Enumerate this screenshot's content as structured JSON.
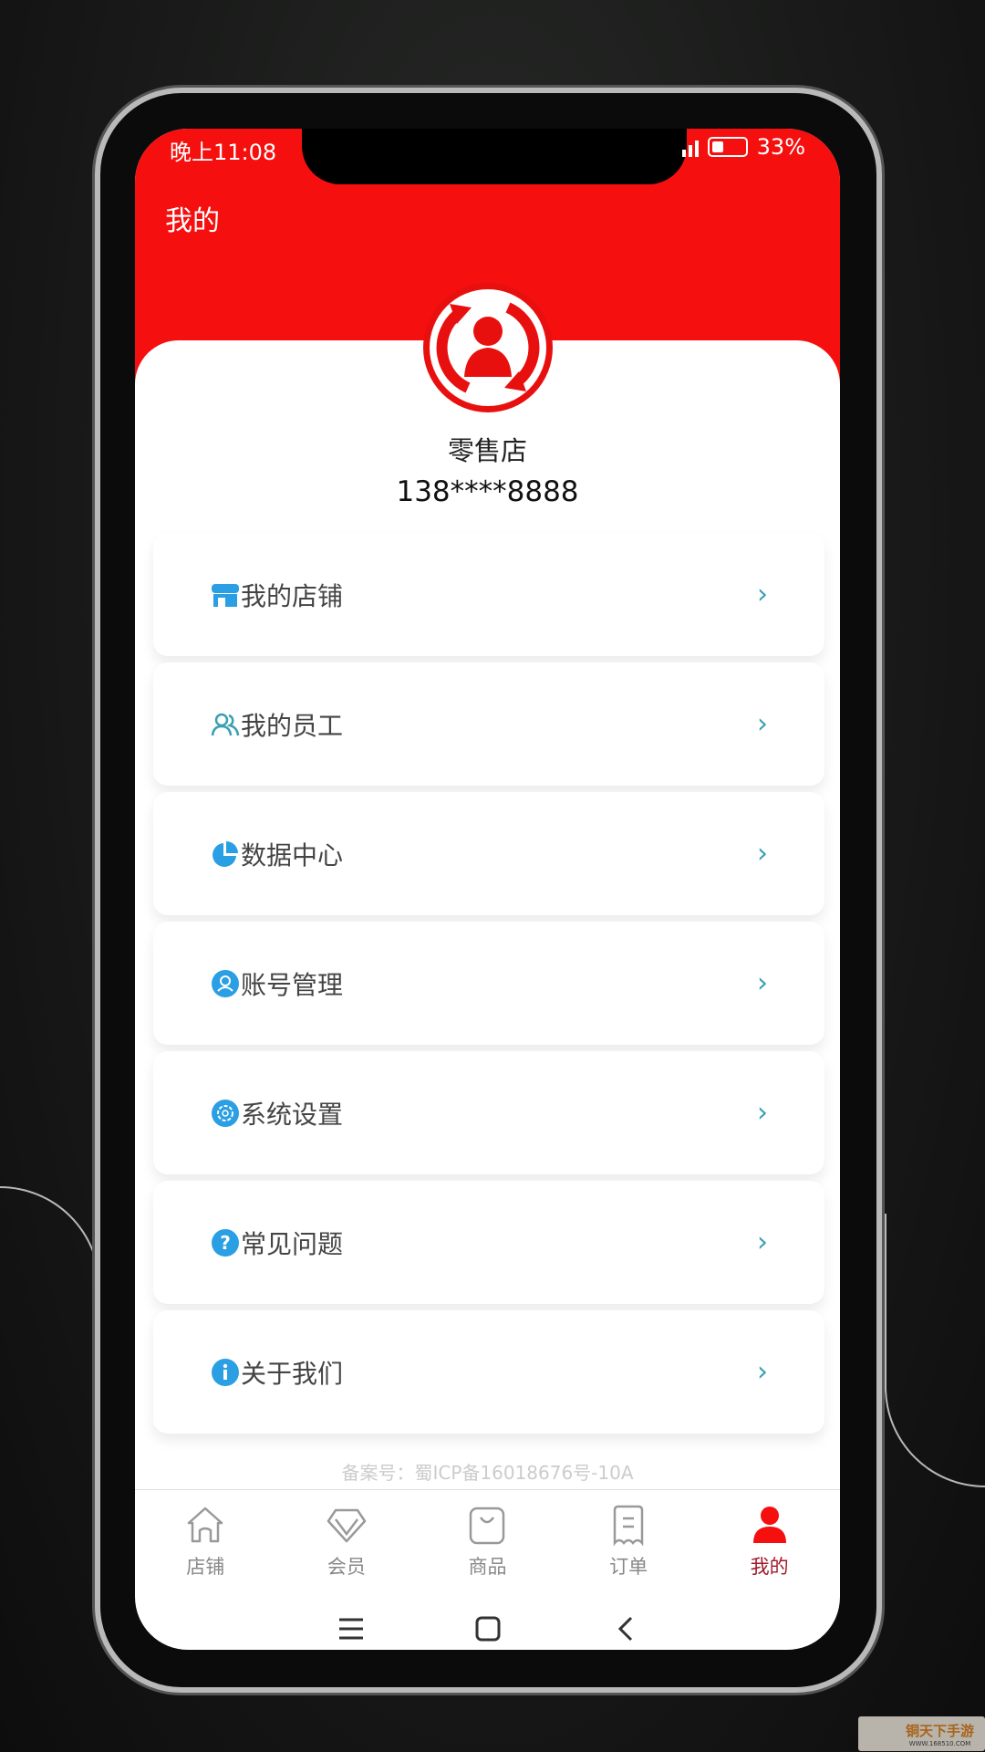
{
  "status_bar": {
    "time": "晚上11:08",
    "battery": "33%"
  },
  "header": {
    "title": "我的"
  },
  "profile": {
    "name": "零售店",
    "phone": "138****8888"
  },
  "menu": [
    {
      "label": "我的店铺",
      "icon": "store-icon"
    },
    {
      "label": "我的员工",
      "icon": "staff-icon"
    },
    {
      "label": "数据中心",
      "icon": "pie-chart-icon"
    },
    {
      "label": "账号管理",
      "icon": "account-icon"
    },
    {
      "label": "系统设置",
      "icon": "settings-icon"
    },
    {
      "label": "常见问题",
      "icon": "question-icon"
    },
    {
      "label": "关于我们",
      "icon": "info-icon"
    }
  ],
  "filing": "备案号：蜀ICP备16018676号-10A",
  "tabs": [
    {
      "label": "店铺",
      "icon": "home-icon"
    },
    {
      "label": "会员",
      "icon": "diamond-icon"
    },
    {
      "label": "商品",
      "icon": "bag-icon"
    },
    {
      "label": "订单",
      "icon": "receipt-icon"
    },
    {
      "label": "我的",
      "icon": "user-icon",
      "active": true
    }
  ],
  "watermark": {
    "name": "铜天下手游",
    "url": "WWW.168510.COM"
  },
  "colors": {
    "brand_red": "#f50f0f",
    "icon_blue": "#2a9fe4",
    "chevron": "#3aa0b0",
    "active_tab": "#a01a2a"
  }
}
